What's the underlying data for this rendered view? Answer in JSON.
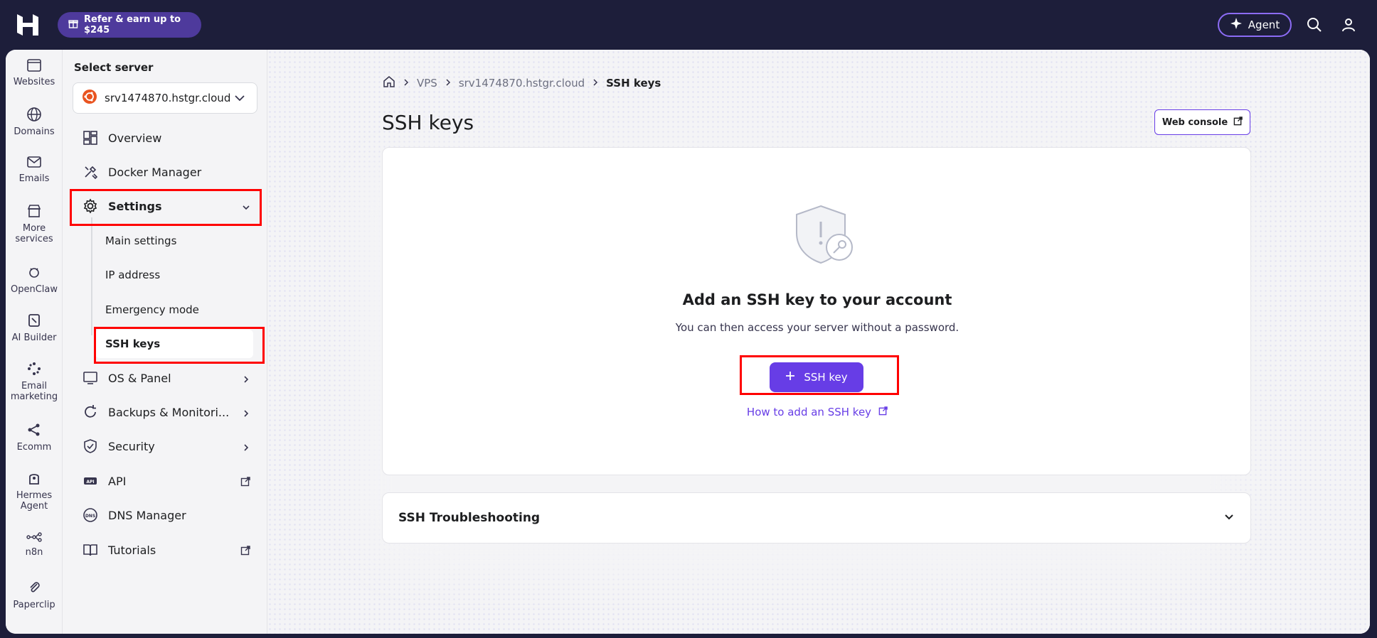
{
  "topbar": {
    "refer_label": "Refer & earn up to $245",
    "agent_label": "Agent"
  },
  "rail": {
    "items": [
      {
        "label": "Websites",
        "icon": "browser-icon"
      },
      {
        "label": "Domains",
        "icon": "globe-icon"
      },
      {
        "label": "Emails",
        "icon": "mail-icon"
      },
      {
        "label": "More services",
        "icon": "store-icon"
      },
      {
        "label": "OpenClaw",
        "icon": "claw-icon"
      },
      {
        "label": "AI Builder",
        "icon": "ai-builder-icon"
      },
      {
        "label": "Email marketing",
        "icon": "email-marketing-icon"
      },
      {
        "label": "Ecomm",
        "icon": "ecomm-icon"
      },
      {
        "label": "Hermes Agent",
        "icon": "hermes-icon"
      },
      {
        "label": "n8n",
        "icon": "n8n-icon"
      },
      {
        "label": "Paperclip",
        "icon": "paperclip-icon"
      }
    ]
  },
  "sidebar": {
    "title": "Select server",
    "server": "srv1474870.hstgr.cloud",
    "items": [
      {
        "label": "Overview"
      },
      {
        "label": "Docker Manager"
      },
      {
        "label": "Settings"
      },
      {
        "label": "OS & Panel"
      },
      {
        "label": "Backups & Monitori..."
      },
      {
        "label": "Security"
      },
      {
        "label": "API"
      },
      {
        "label": "DNS Manager"
      },
      {
        "label": "Tutorials"
      }
    ],
    "settings_sub": [
      {
        "label": "Main settings"
      },
      {
        "label": "IP address"
      },
      {
        "label": "Emergency mode"
      },
      {
        "label": "SSH keys"
      }
    ]
  },
  "breadcrumb": {
    "items": [
      "VPS",
      "srv1474870.hstgr.cloud"
    ],
    "current": "SSH keys"
  },
  "main": {
    "title": "SSH keys",
    "web_console": "Web console",
    "empty_title": "Add an SSH key to your account",
    "empty_subtitle": "You can then access your server without a password.",
    "add_button": "SSH key",
    "how_link": "How to add an SSH key",
    "accordion_title": "SSH Troubleshooting"
  },
  "colors": {
    "accent": "#673de6",
    "topbar": "#1d1e3a",
    "highlight": "#ff0000"
  }
}
